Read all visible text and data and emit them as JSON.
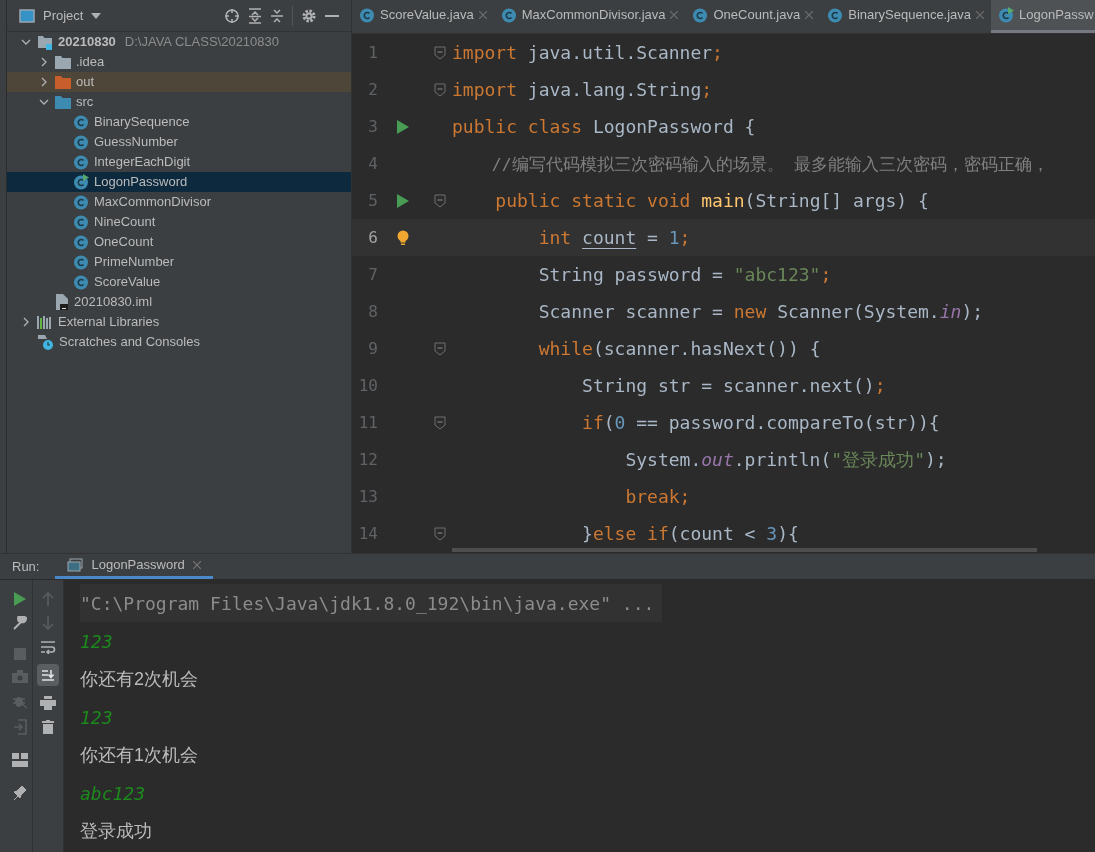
{
  "project_panel": {
    "title": "Project",
    "tree": [
      {
        "label": "20210830",
        "path": "D:\\JAVA CLASS\\20210830",
        "kind": "module",
        "expanded": true,
        "selected": false,
        "children": [
          {
            "label": ".idea",
            "kind": "folder",
            "expanded": false,
            "selected": false
          },
          {
            "label": "out",
            "kind": "excluded-folder",
            "expanded": false,
            "selected": false
          },
          {
            "label": "src",
            "kind": "source-folder",
            "expanded": true,
            "selected": false,
            "children": [
              {
                "label": "BinarySequence",
                "kind": "class",
                "selected": false
              },
              {
                "label": "GuessNumber",
                "kind": "class",
                "selected": false
              },
              {
                "label": "IntegerEachDigit",
                "kind": "class",
                "selected": false
              },
              {
                "label": "LogonPassword",
                "kind": "main-class",
                "selected": true
              },
              {
                "label": "MaxCommonDivisor",
                "kind": "class",
                "selected": false
              },
              {
                "label": "NineCount",
                "kind": "class",
                "selected": false
              },
              {
                "label": "OneCount",
                "kind": "class",
                "selected": false
              },
              {
                "label": "PrimeNumber",
                "kind": "class",
                "selected": false
              },
              {
                "label": "ScoreValue",
                "kind": "class",
                "selected": false
              }
            ]
          },
          {
            "label": "20210830.iml",
            "kind": "file",
            "selected": false
          }
        ]
      },
      {
        "label": "External Libraries",
        "kind": "library",
        "expanded": false,
        "selected": false
      },
      {
        "label": "Scratches and Consoles",
        "kind": "scratches",
        "selected": false
      }
    ]
  },
  "editor_tabs": [
    {
      "label": "ScoreValue.java",
      "kind": "class",
      "selected": false
    },
    {
      "label": "MaxCommonDivisor.java",
      "kind": "class",
      "selected": false
    },
    {
      "label": "OneCount.java",
      "kind": "class",
      "selected": false
    },
    {
      "label": "BinarySequence.java",
      "kind": "class",
      "selected": false
    },
    {
      "label": "LogonPassw",
      "kind": "main-class",
      "selected": true
    }
  ],
  "code_lines": [
    {
      "number": "1",
      "run": false,
      "fold": true,
      "current": false,
      "tokens": [
        {
          "text": "import ",
          "kind": "keyword"
        },
        {
          "text": "java.util.Scanner",
          "kind": "plain"
        },
        {
          "text": ";",
          "kind": "keyword"
        }
      ]
    },
    {
      "number": "2",
      "run": false,
      "fold": true,
      "current": false,
      "tokens": [
        {
          "text": "import ",
          "kind": "keyword"
        },
        {
          "text": "java.lang.String",
          "kind": "plain"
        },
        {
          "text": ";",
          "kind": "keyword"
        }
      ]
    },
    {
      "number": "3",
      "run": true,
      "fold": false,
      "current": false,
      "tokens": [
        {
          "text": "public class ",
          "kind": "keyword"
        },
        {
          "text": "LogonPassword {",
          "kind": "plain"
        }
      ]
    },
    {
      "number": "4",
      "run": false,
      "fold": false,
      "current": false,
      "tokens": [
        {
          "text": "    //编写代码模拟三次密码输入的场景。 最多能输入三次密码，密码正确，",
          "kind": "comment"
        }
      ]
    },
    {
      "number": "5",
      "run": true,
      "fold": true,
      "current": false,
      "tokens": [
        {
          "text": "    public static void ",
          "kind": "keyword"
        },
        {
          "text": "main",
          "kind": "method"
        },
        {
          "text": "(String[] args) {",
          "kind": "plain"
        }
      ]
    },
    {
      "number": "6",
      "run": false,
      "fold": false,
      "current": true,
      "tokens": [
        {
          "text": "        int ",
          "kind": "keyword"
        },
        {
          "text": "count",
          "kind": "reassigned"
        },
        {
          "text": " = ",
          "kind": "plain"
        },
        {
          "text": "1",
          "kind": "number"
        },
        {
          "text": ";",
          "kind": "keyword"
        }
      ]
    },
    {
      "number": "7",
      "run": false,
      "fold": false,
      "current": false,
      "tokens": [
        {
          "text": "        String password = ",
          "kind": "plain"
        },
        {
          "text": "\"abc123\"",
          "kind": "string"
        },
        {
          "text": ";",
          "kind": "keyword"
        }
      ]
    },
    {
      "number": "8",
      "run": false,
      "fold": false,
      "current": false,
      "tokens": [
        {
          "text": "        Scanner scanner = ",
          "kind": "plain"
        },
        {
          "text": "new ",
          "kind": "keyword"
        },
        {
          "text": "Scanner(System.",
          "kind": "plain"
        },
        {
          "text": "in",
          "kind": "static-field"
        },
        {
          "text": ");",
          "kind": "plain"
        }
      ]
    },
    {
      "number": "9",
      "run": false,
      "fold": true,
      "current": false,
      "tokens": [
        {
          "text": "        while",
          "kind": "keyword"
        },
        {
          "text": "(scanner.hasNext()) {",
          "kind": "plain"
        }
      ]
    },
    {
      "number": "10",
      "run": false,
      "fold": false,
      "current": false,
      "tokens": [
        {
          "text": "            String str = scanner.next()",
          "kind": "plain"
        },
        {
          "text": ";",
          "kind": "keyword"
        }
      ]
    },
    {
      "number": "11",
      "run": false,
      "fold": true,
      "current": false,
      "tokens": [
        {
          "text": "            if",
          "kind": "keyword"
        },
        {
          "text": "(",
          "kind": "plain"
        },
        {
          "text": "0",
          "kind": "number"
        },
        {
          "text": " == password.compareTo(str)){",
          "kind": "plain"
        }
      ]
    },
    {
      "number": "12",
      "run": false,
      "fold": false,
      "current": false,
      "tokens": [
        {
          "text": "                System.",
          "kind": "plain"
        },
        {
          "text": "out",
          "kind": "static-field"
        },
        {
          "text": ".println(",
          "kind": "plain"
        },
        {
          "text": "\"登录成功\"",
          "kind": "string"
        },
        {
          "text": ");",
          "kind": "plain"
        }
      ]
    },
    {
      "number": "13",
      "run": false,
      "fold": false,
      "current": false,
      "tokens": [
        {
          "text": "                break;",
          "kind": "keyword"
        }
      ]
    },
    {
      "number": "14",
      "run": false,
      "fold": true,
      "current": false,
      "tokens": [
        {
          "text": "            }",
          "kind": "plain"
        },
        {
          "text": "else if",
          "kind": "keyword"
        },
        {
          "text": "(count < ",
          "kind": "plain"
        },
        {
          "text": "3",
          "kind": "number"
        },
        {
          "text": "){",
          "kind": "plain"
        }
      ]
    }
  ],
  "run_panel": {
    "label": "Run:",
    "tab": "LogonPassword",
    "console": [
      {
        "text": "\"C:\\Program Files\\Java\\jdk1.8.0_192\\bin\\java.exe\" ...",
        "kind": "command"
      },
      {
        "text": "123",
        "kind": "input"
      },
      {
        "text": "你还有2次机会",
        "kind": "output"
      },
      {
        "text": "123",
        "kind": "input"
      },
      {
        "text": "你还有1次机会",
        "kind": "output"
      },
      {
        "text": "abc123",
        "kind": "input"
      },
      {
        "text": "登录成功",
        "kind": "output"
      }
    ]
  }
}
